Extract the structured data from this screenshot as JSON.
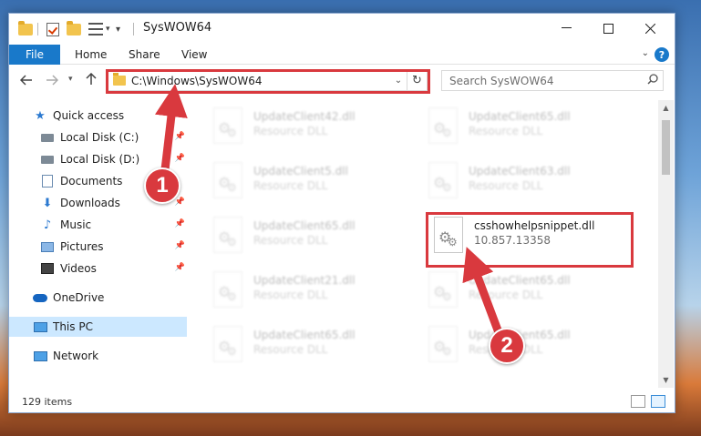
{
  "window": {
    "title": "SysWOW64"
  },
  "ribbon": {
    "tabs": [
      "File",
      "Home",
      "Share",
      "View"
    ],
    "help_label": "?"
  },
  "nav": {
    "address": "C:\\Windows\\SysWOW64",
    "search_placeholder": "Search SysWOW64"
  },
  "sidebar": {
    "items": [
      {
        "label": "Quick access",
        "icon": "star-icon"
      },
      {
        "label": "Local Disk (C:)",
        "icon": "drive-icon"
      },
      {
        "label": "Local Disk (D:)",
        "icon": "drive-icon"
      },
      {
        "label": "Documents",
        "icon": "documents-icon"
      },
      {
        "label": "Downloads",
        "icon": "downloads-icon"
      },
      {
        "label": "Music",
        "icon": "music-icon"
      },
      {
        "label": "Pictures",
        "icon": "pictures-icon"
      },
      {
        "label": "Videos",
        "icon": "videos-icon"
      },
      {
        "label": "OneDrive",
        "icon": "onedrive-icon"
      },
      {
        "label": "This PC",
        "icon": "this-pc-icon"
      },
      {
        "label": "Network",
        "icon": "network-icon"
      }
    ]
  },
  "files": [
    {
      "name": "UpdateClient42.dll",
      "type": "Resource DLL"
    },
    {
      "name": "UpdateClient65.dll",
      "type": "Resource DLL"
    },
    {
      "name": "UpdateClient5.dll",
      "type": "Resource DLL"
    },
    {
      "name": "UpdateClient63.dll",
      "type": "Resource DLL"
    },
    {
      "name": "UpdateClient65.dll",
      "type": "Resource DLL"
    },
    {
      "name": "csshowhelpsnippet.dll",
      "type": "10.857.13358"
    },
    {
      "name": "UpdateClient21.dll",
      "type": "Resource DLL"
    },
    {
      "name": "UpdateClient65.dll",
      "type": "Resource DLL"
    },
    {
      "name": "UpdateClient65.dll",
      "type": "Resource DLL"
    },
    {
      "name": "UpdateClient65.dll",
      "type": "Resource DLL"
    }
  ],
  "status": {
    "item_count": "129 items"
  },
  "callouts": {
    "step1": "1",
    "step2": "2"
  },
  "colors": {
    "accent": "#1979ca",
    "highlight": "#d9393e",
    "selection": "#cce8ff"
  }
}
